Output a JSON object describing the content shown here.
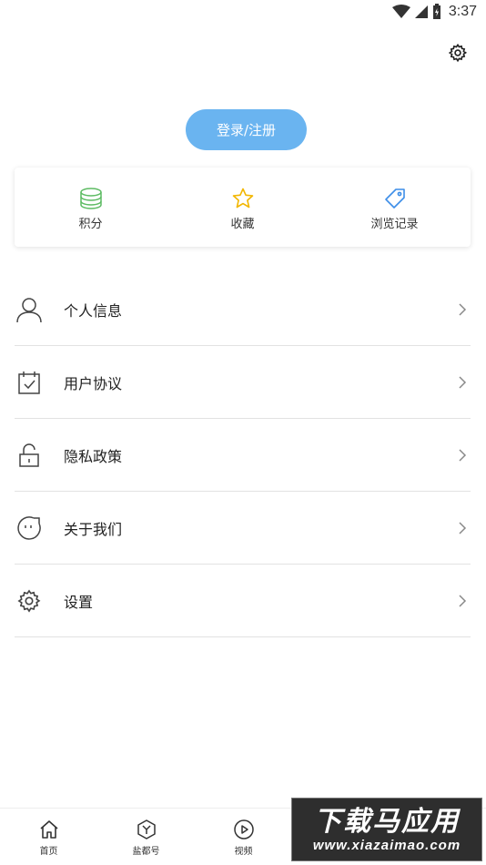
{
  "status_bar": {
    "time": "3:37"
  },
  "login": {
    "label": "登录/注册"
  },
  "quick_actions": [
    {
      "label": "积分",
      "icon": "coins-stack-icon",
      "color": "#5dbb63"
    },
    {
      "label": "收藏",
      "icon": "star-icon",
      "color": "#f2b600"
    },
    {
      "label": "浏览记录",
      "icon": "tag-icon",
      "color": "#3d8ee8"
    }
  ],
  "menu": [
    {
      "label": "个人信息",
      "icon": "person-icon"
    },
    {
      "label": "用户协议",
      "icon": "calendar-check-icon"
    },
    {
      "label": "隐私政策",
      "icon": "unlock-icon"
    },
    {
      "label": "关于我们",
      "icon": "smiley-icon"
    },
    {
      "label": "设置",
      "icon": "gear-icon"
    }
  ],
  "tabs": [
    {
      "label": "首页",
      "icon": "home-icon"
    },
    {
      "label": "盐都号",
      "icon": "hexagon-y-icon"
    },
    {
      "label": "视频",
      "icon": "play-circle-icon"
    }
  ],
  "watermark": {
    "title": "下载马应用",
    "url": "www.xiazaimao.com"
  },
  "colors": {
    "accent": "#6ab4f0",
    "divider": "#e2e2e2"
  }
}
